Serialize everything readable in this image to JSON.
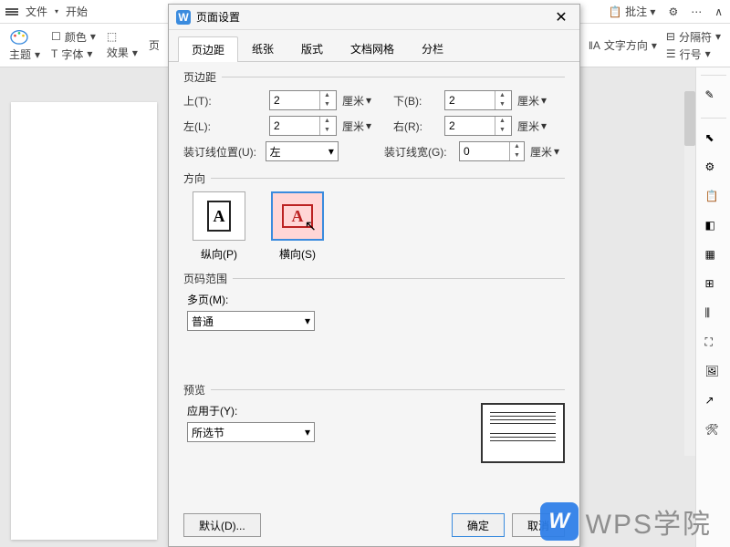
{
  "topbar": {
    "file_menu": "文件",
    "start": "开始"
  },
  "ribbon": {
    "theme": "主题",
    "color": "颜色",
    "font": "字体",
    "effects": "效果",
    "page": "页",
    "text_direction": "文字方向",
    "separator": "分隔符",
    "line_number": "行号"
  },
  "top_right": {
    "comments": "批注"
  },
  "dialog": {
    "title": "页面设置",
    "tabs": {
      "margin": "页边距",
      "paper": "纸张",
      "layout": "版式",
      "grid": "文档网格",
      "columns": "分栏"
    },
    "margins": {
      "section": "页边距",
      "top_label": "上(T):",
      "top_value": "2",
      "bottom_label": "下(B):",
      "bottom_value": "2",
      "left_label": "左(L):",
      "left_value": "2",
      "right_label": "右(R):",
      "right_value": "2",
      "gutter_pos_label": "装订线位置(U):",
      "gutter_pos_value": "左",
      "gutter_width_label": "装订线宽(G):",
      "gutter_width_value": "0",
      "unit": "厘米"
    },
    "orientation": {
      "section": "方向",
      "portrait": "纵向(P)",
      "landscape": "横向(S)",
      "selected": "landscape"
    },
    "page_range": {
      "section": "页码范围",
      "multi_label": "多页(M):",
      "multi_value": "普通"
    },
    "preview": {
      "section": "预览",
      "apply_label": "应用于(Y):",
      "apply_value": "所选节"
    },
    "buttons": {
      "default": "默认(D)...",
      "ok": "确定",
      "cancel": "取消"
    }
  },
  "watermark": {
    "text": "WPS学院"
  }
}
